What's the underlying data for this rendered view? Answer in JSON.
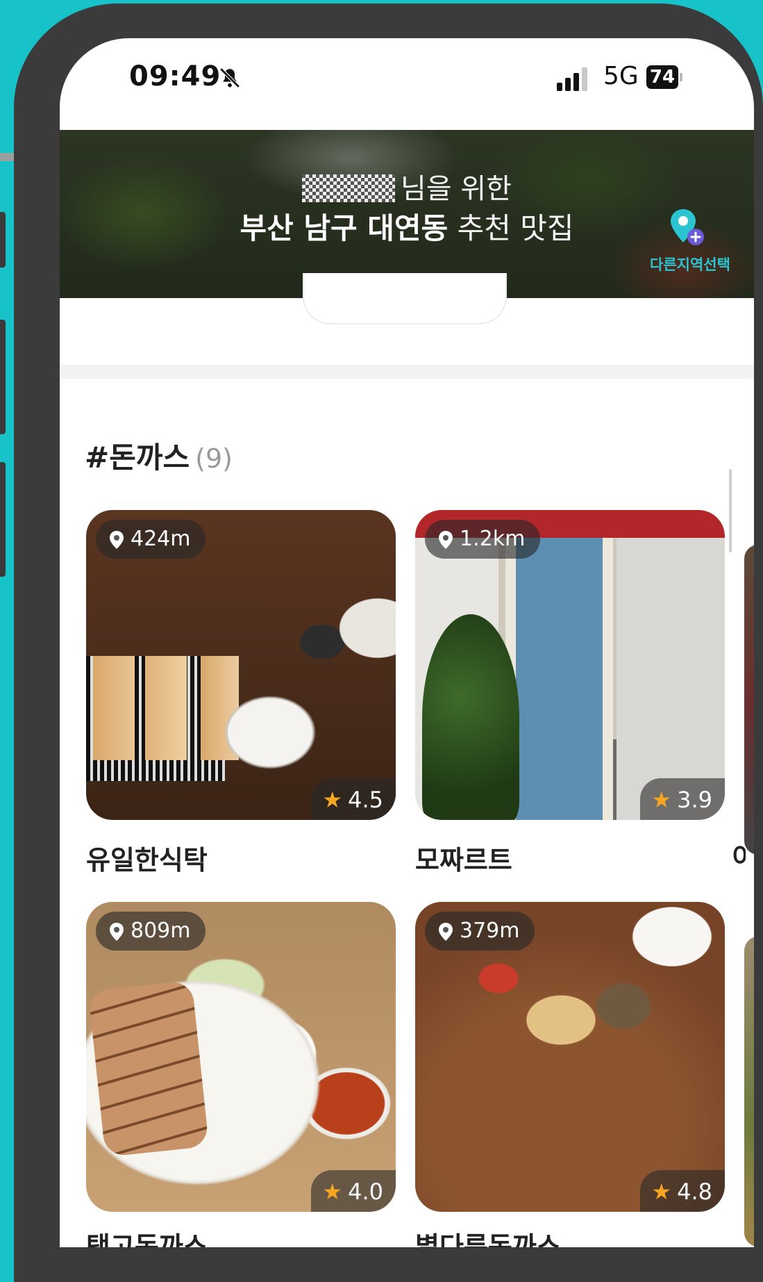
{
  "status_bar": {
    "time": "09:49",
    "network": "5G",
    "battery": "74",
    "icons": [
      "bell-muted-icon",
      "signal-icon",
      "battery-icon"
    ]
  },
  "hero": {
    "line1_suffix": "님을 위한",
    "region_bold": "부산 남구 대연동",
    "line2_suffix": "추천 맛집",
    "region_select_label": "다른지역선택",
    "region_select_icon": "map-pin-icon"
  },
  "section": {
    "title": "#돈까스",
    "count": "(9)"
  },
  "colors": {
    "accent": "#2bc4d0",
    "background": "#17c3c8",
    "star": "#f5a623"
  },
  "cards": [
    {
      "distance": "424m",
      "rating": "4.5",
      "name": "유일한식탁"
    },
    {
      "distance": "1.2km",
      "rating": "3.9",
      "name": "모짜르트"
    },
    {
      "distance": "809m",
      "rating": "4.0",
      "name": "탱고돈까스"
    },
    {
      "distance": "379m",
      "rating": "4.8",
      "name": "별다른돈까스"
    }
  ],
  "peek_text": "이"
}
